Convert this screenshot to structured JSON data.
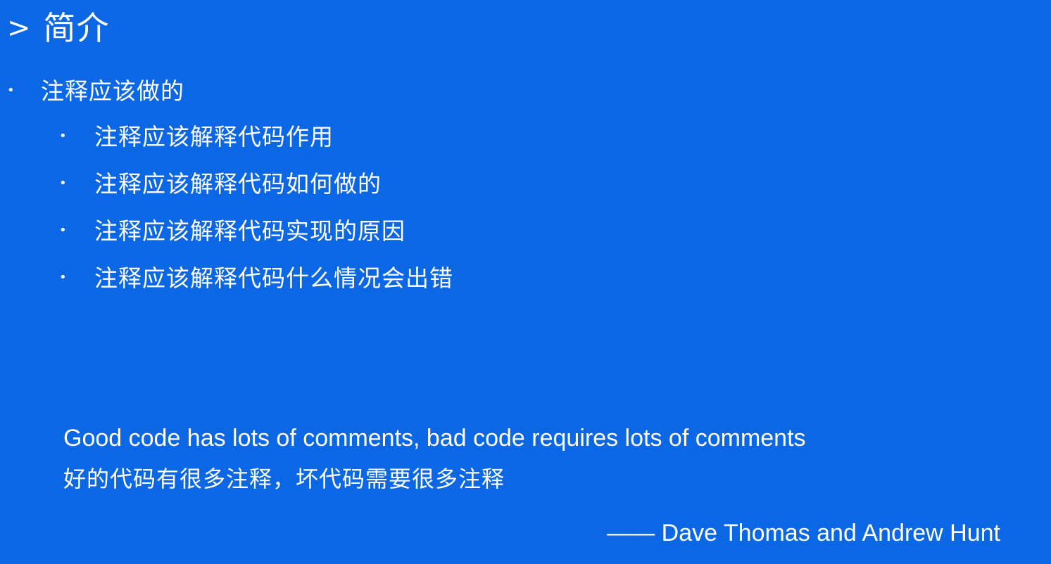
{
  "slide": {
    "title_marker": ">",
    "title": "简介",
    "bullets": {
      "level1_symbol": "•",
      "level1_text": "注释应该做的",
      "level2": [
        {
          "symbol": "•",
          "text": "注释应该解释代码作用"
        },
        {
          "symbol": "•",
          "text": "注释应该解释代码如何做的"
        },
        {
          "symbol": "•",
          "text": "注释应该解释代码实现的原因"
        },
        {
          "symbol": "•",
          "text": "注释应该解释代码什么情况会出错"
        }
      ]
    },
    "quote": {
      "english": "Good code has lots of comments, bad code requires lots of comments",
      "chinese": "好的代码有很多注释，坏代码需要很多注释",
      "attribution": "—— Dave Thomas and Andrew Hunt"
    },
    "colors": {
      "background": "#0b67e4",
      "text": "#ffffff"
    }
  }
}
